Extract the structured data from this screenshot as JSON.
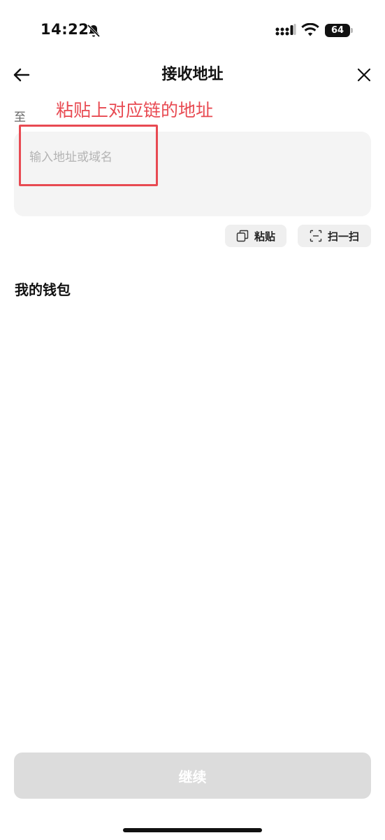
{
  "status_bar": {
    "time": "14:22",
    "battery": "64",
    "icons": [
      "bell-slash-icon",
      "signal-icon",
      "wifi-icon",
      "battery-icon"
    ]
  },
  "header": {
    "title": "接收地址",
    "back_icon": "arrow-left-icon",
    "close_icon": "close-icon"
  },
  "form": {
    "to_label": "至",
    "annotation": "粘贴上对应链的地址",
    "address": {
      "value": "",
      "placeholder": "输入地址或域名"
    },
    "paste_label": "粘贴",
    "scan_label": "扫一扫"
  },
  "wallets": {
    "title": "我的钱包"
  },
  "footer": {
    "continue_label": "继续"
  },
  "colors": {
    "annotation": "#e84a52",
    "input_bg": "#f4f4f4",
    "disabled_button": "#dcdcdc"
  }
}
